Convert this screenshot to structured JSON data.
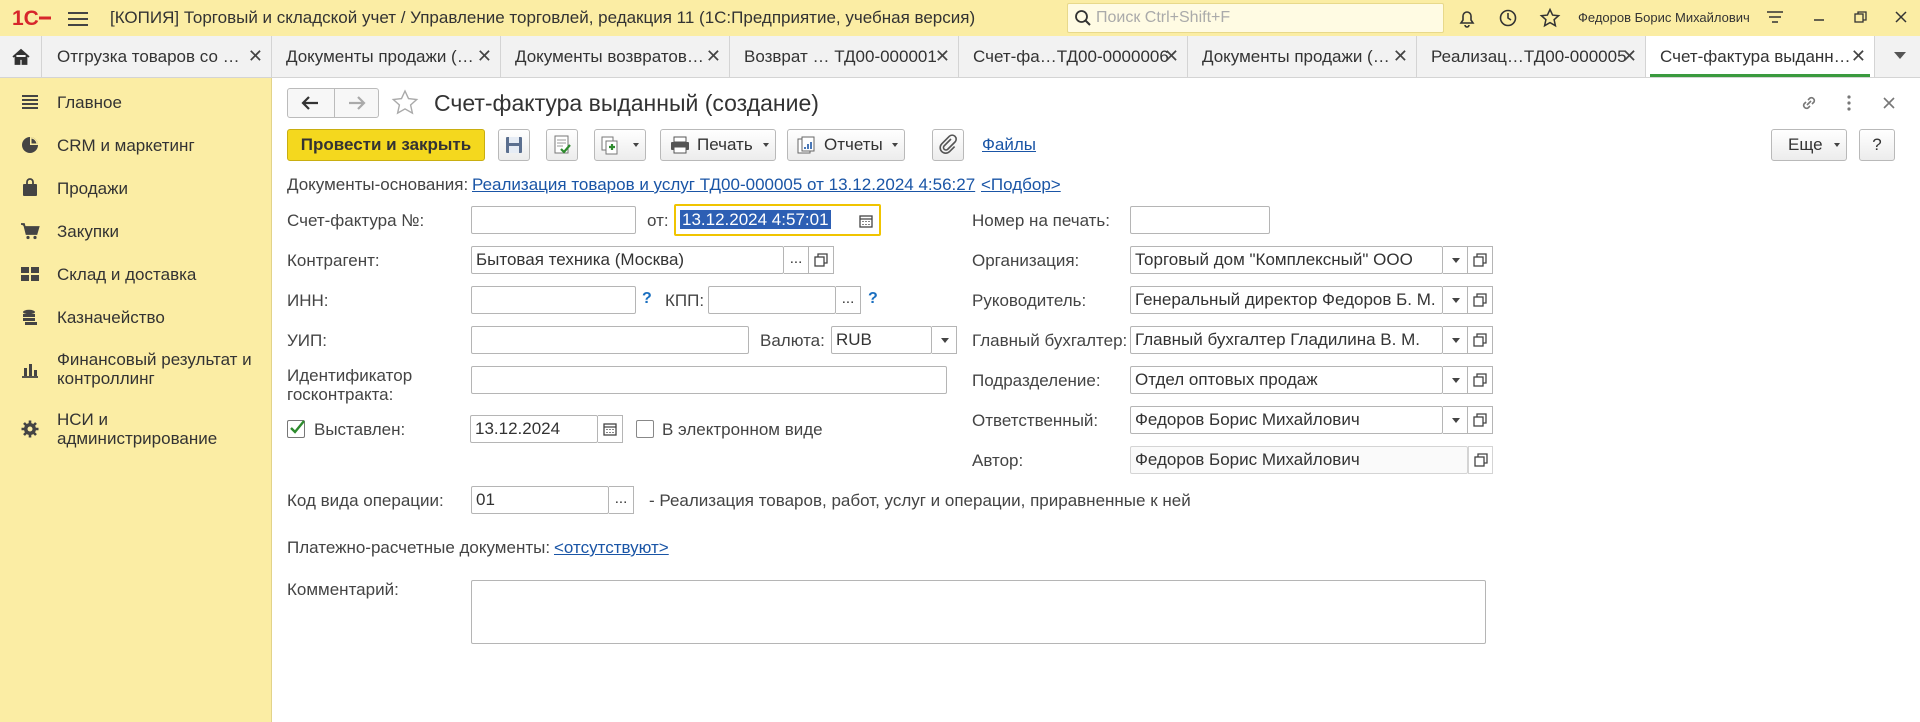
{
  "app": {
    "title": "[КОПИЯ] Торговый и складской учет / Управление торговлей, редакция 11  (1С:Предприятие, учебная версия)",
    "search_placeholder": "Поиск Ctrl+Shift+F",
    "user": "Федоров Борис Михайлович"
  },
  "tabs": [
    {
      "label": "Отгрузка товаров со …"
    },
    {
      "label": "Документы продажи (…"
    },
    {
      "label": "Документы возвратов…"
    },
    {
      "label": "Возврат … ТД00-000001"
    },
    {
      "label": "Счет-фа…ТД00-0000006"
    },
    {
      "label": "Документы продажи (…"
    },
    {
      "label": "Реализац…ТД00-000005"
    },
    {
      "label": "Счет-фактура выданн…",
      "active": true
    }
  ],
  "sidebar": {
    "items": [
      {
        "label": "Главное",
        "icon": "menu-lines-icon"
      },
      {
        "label": "CRM и маркетинг",
        "icon": "pie-chart-icon"
      },
      {
        "label": "Продажи",
        "icon": "shopping-bag-icon"
      },
      {
        "label": "Закупки",
        "icon": "cart-icon"
      },
      {
        "label": "Склад и доставка",
        "icon": "warehouse-grid-icon"
      },
      {
        "label": "Казначейство",
        "icon": "coins-icon"
      },
      {
        "label": "Финансовый результат и контроллинг",
        "icon": "bar-chart-icon"
      },
      {
        "label": "НСИ и администрирование",
        "icon": "gear-icon"
      }
    ]
  },
  "form": {
    "title": "Счет-фактура выданный (создание)",
    "toolbar": {
      "post_close": "Провести и закрыть",
      "print": "Печать",
      "reports": "Отчеты",
      "files": "Файлы",
      "more": "Еще",
      "help": "?"
    },
    "basis_label": "Документы-основания:",
    "basis_link": "Реализация товаров и услуг ТД00-000005 от 13.12.2024 4:56:27",
    "pick_link": "<Подбор>",
    "invoice_no_label": "Счет-фактура №:",
    "invoice_no": "",
    "from_label": "от:",
    "date_value": "13.12.2024  4:57:01",
    "print_no_label": "Номер на печать:",
    "print_no": "",
    "counterparty_label": "Контрагент:",
    "counterparty": "Бытовая техника (Москва)",
    "org_label": "Организация:",
    "org": "Торговый дом \"Комплексный\" ООО",
    "inn_label": "ИНН:",
    "inn": "",
    "kpp_label": "КПП:",
    "kpp": "",
    "q_mark": "?",
    "head_label": "Руководитель:",
    "head": "Генеральный директор Федоров Б. М.",
    "uip_label": "УИП:",
    "uip": "",
    "currency_label": "Валюта:",
    "currency": "RUB",
    "accountant_label": "Главный бухгалтер:",
    "accountant": "Главный бухгалтер Гладилина В. М.",
    "contract_id_label": "Идентификатор госконтракта:",
    "contract_id": "",
    "dept_label": "Подразделение:",
    "dept": "Отдел оптовых продаж",
    "issued_label": "Выставлен:",
    "issued_checked": true,
    "issued_date": "13.12.2024",
    "electronic_label": "В электронном виде",
    "electronic_checked": false,
    "responsible_label": "Ответственный:",
    "responsible": "Федоров Борис Михайлович",
    "author_label": "Автор:",
    "author": "Федоров Борис Михайлович",
    "op_code_label": "Код вида операции:",
    "op_code": "01",
    "op_code_desc": "- Реализация товаров, работ, услуг и операции, приравненные к ней",
    "payment_docs_label": "Платежно-расчетные документы:",
    "payment_docs_link": "<отсутствуют>",
    "comment_label": "Комментарий:",
    "comment": ""
  },
  "colors": {
    "sidebar_bg": "#fbeda4",
    "primary_button": "#f4d81e",
    "link": "#1a55a6",
    "active_tab_underline": "#3a9a3e",
    "logo_red": "#d7262b"
  }
}
